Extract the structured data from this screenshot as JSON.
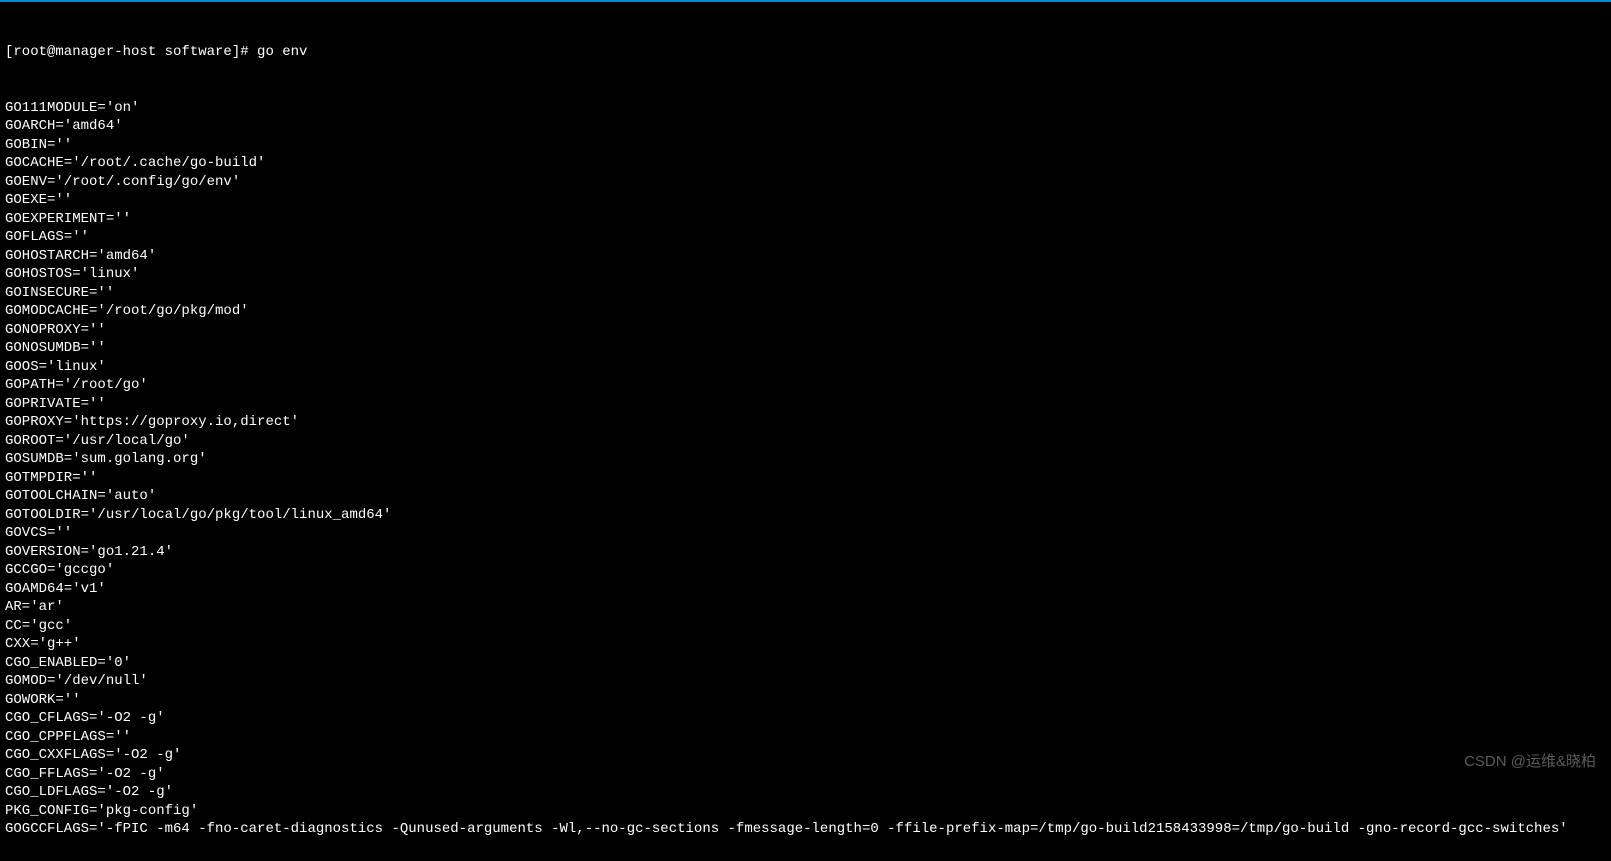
{
  "terminal": {
    "prompt": "[root@manager-host software]# go env",
    "lines": [
      "GO111MODULE='on'",
      "GOARCH='amd64'",
      "GOBIN=''",
      "GOCACHE='/root/.cache/go-build'",
      "GOENV='/root/.config/go/env'",
      "GOEXE=''",
      "GOEXPERIMENT=''",
      "GOFLAGS=''",
      "GOHOSTARCH='amd64'",
      "GOHOSTOS='linux'",
      "GOINSECURE=''",
      "GOMODCACHE='/root/go/pkg/mod'",
      "GONOPROXY=''",
      "GONOSUMDB=''",
      "GOOS='linux'",
      "GOPATH='/root/go'",
      "GOPRIVATE=''",
      "GOPROXY='https://goproxy.io,direct'",
      "GOROOT='/usr/local/go'",
      "GOSUMDB='sum.golang.org'",
      "GOTMPDIR=''",
      "GOTOOLCHAIN='auto'",
      "GOTOOLDIR='/usr/local/go/pkg/tool/linux_amd64'",
      "GOVCS=''",
      "GOVERSION='go1.21.4'",
      "GCCGO='gccgo'",
      "GOAMD64='v1'",
      "AR='ar'",
      "CC='gcc'",
      "CXX='g++'",
      "CGO_ENABLED='0'",
      "GOMOD='/dev/null'",
      "GOWORK=''",
      "CGO_CFLAGS='-O2 -g'",
      "CGO_CPPFLAGS=''",
      "CGO_CXXFLAGS='-O2 -g'",
      "CGO_FFLAGS='-O2 -g'",
      "CGO_LDFLAGS='-O2 -g'",
      "PKG_CONFIG='pkg-config'",
      "GOGCCFLAGS='-fPIC -m64 -fno-caret-diagnostics -Qunused-arguments -Wl,--no-gc-sections -fmessage-length=0 -ffile-prefix-map=/tmp/go-build2158433998=/tmp/go-build -gno-record-gcc-switches'"
    ]
  },
  "watermark": "CSDN @运维&晓柏"
}
